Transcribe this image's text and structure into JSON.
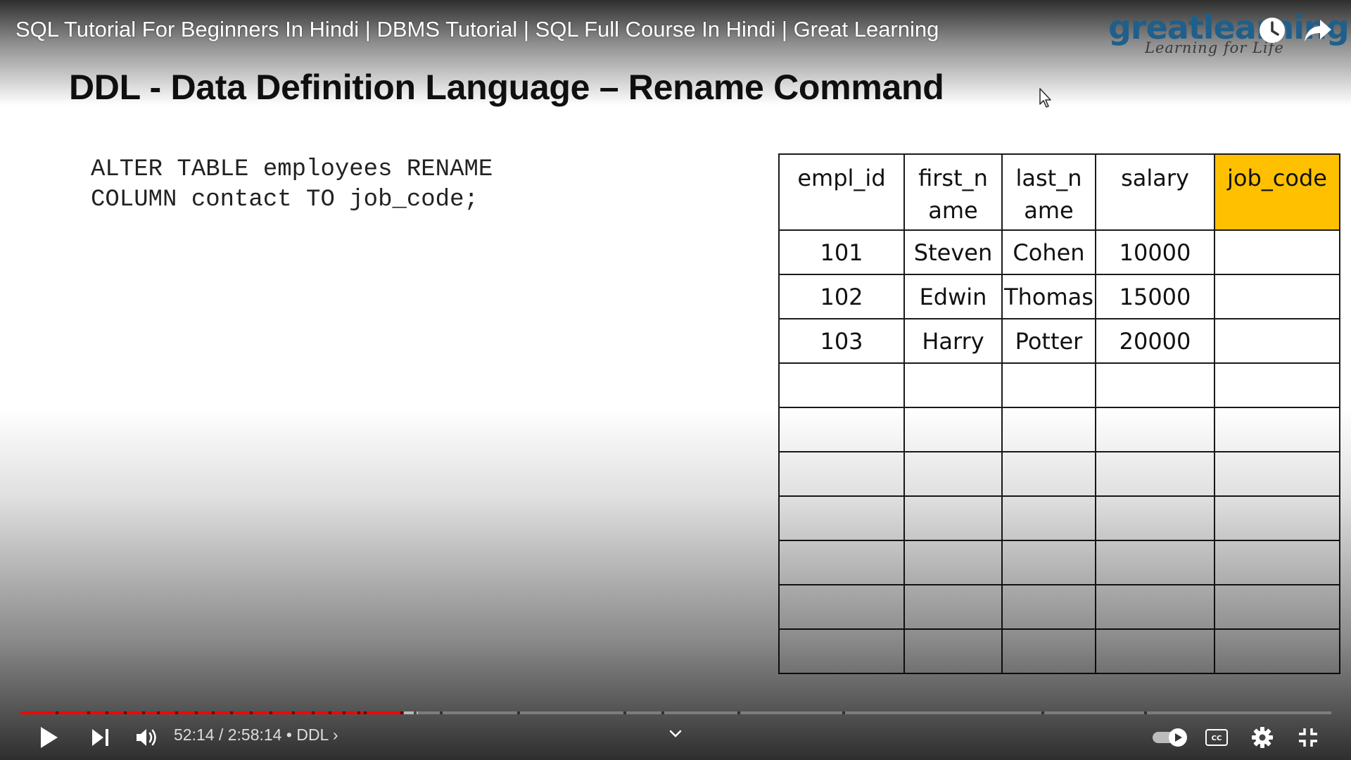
{
  "video": {
    "title": "SQL Tutorial For Beginners In Hindi | DBMS Tutorial | SQL Full Course In Hindi | Great Learning"
  },
  "logo": {
    "name": "greatlearning",
    "tagline": "Learning for Life"
  },
  "slide": {
    "title": "DDL - Data Definition Language – Rename Command",
    "code_line1": "ALTER TABLE employees RENAME",
    "code_line2": "COLUMN contact TO job_code;",
    "table": {
      "headers": [
        "empl_id",
        "first_n\name",
        "last_n\name",
        "salary",
        "job_code"
      ],
      "highlight_color": "#ffc000",
      "rows": [
        [
          "101",
          "Steven",
          "Cohen",
          "10000",
          ""
        ],
        [
          "102",
          "Edwin",
          "Thomas",
          "15000",
          ""
        ],
        [
          "103",
          "Harry",
          "Potter",
          "20000",
          ""
        ],
        [
          "",
          "",
          "",
          "",
          ""
        ],
        [
          "",
          "",
          "",
          "",
          ""
        ],
        [
          "",
          "",
          "",
          "",
          ""
        ],
        [
          "",
          "",
          "",
          "",
          ""
        ],
        [
          "",
          "",
          "",
          "",
          ""
        ],
        [
          "",
          "",
          "",
          "",
          ""
        ],
        [
          "",
          "",
          "",
          "",
          ""
        ]
      ]
    }
  },
  "player": {
    "current_time": "52:14",
    "duration": "2:58:14",
    "separator": "/",
    "chapter": "DDL",
    "progress_fraction": 0.2926,
    "buffered_fraction": 0.3035,
    "accent_color": "#ff0000",
    "icons": [
      "play-icon",
      "next-icon",
      "volume-icon",
      "chevron-down-icon",
      "autoplay-toggle-icon",
      "captions-icon",
      "settings-icon",
      "exit-fullscreen-icon",
      "watch-later-icon",
      "share-icon"
    ]
  }
}
